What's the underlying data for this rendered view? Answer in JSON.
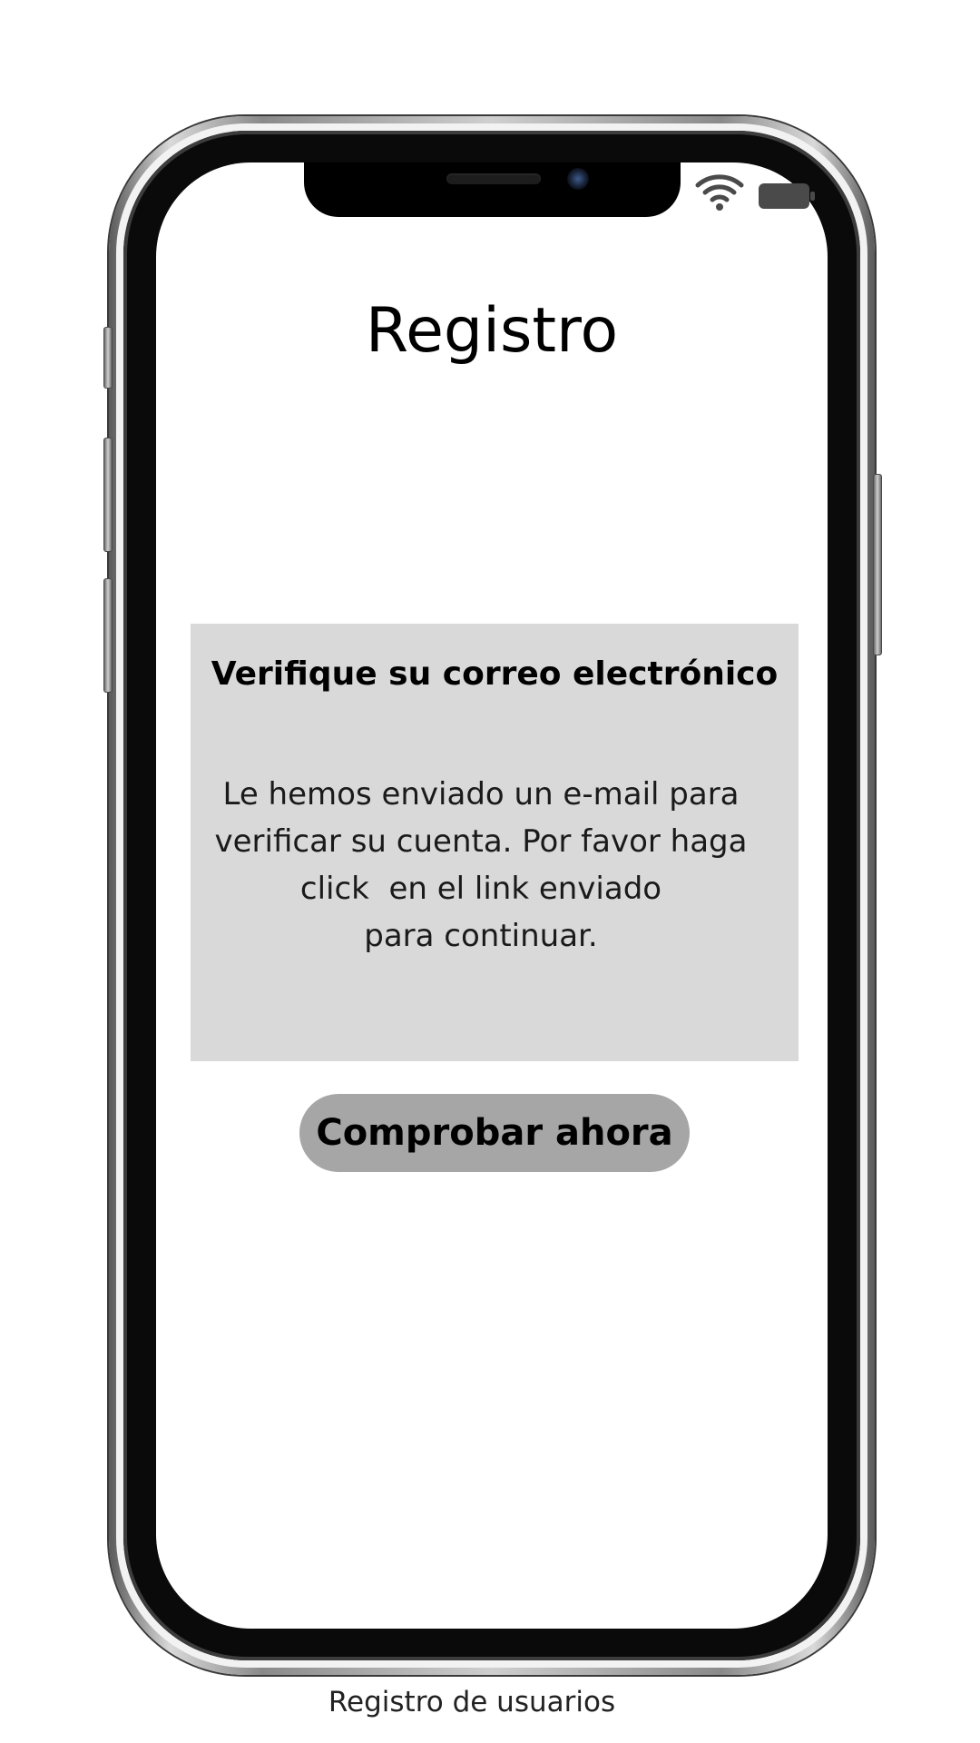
{
  "screen": {
    "title": "Registro",
    "card": {
      "heading": "Verifique su correo electrónico",
      "body_lines": [
        "Le hemos enviado un e-mail para",
        "verificar su cuenta. Por favor haga",
        "click  en el link enviado",
        "para continuar."
      ]
    },
    "primary_button": {
      "label": "Comprobar ahora"
    }
  },
  "status_bar": {
    "icons": [
      "wifi-icon",
      "battery-icon"
    ]
  },
  "caption": "Registro de usuarios",
  "colors": {
    "card_background": "#d9d9d9",
    "button_background": "#a6a6a6",
    "text": "#000000"
  }
}
